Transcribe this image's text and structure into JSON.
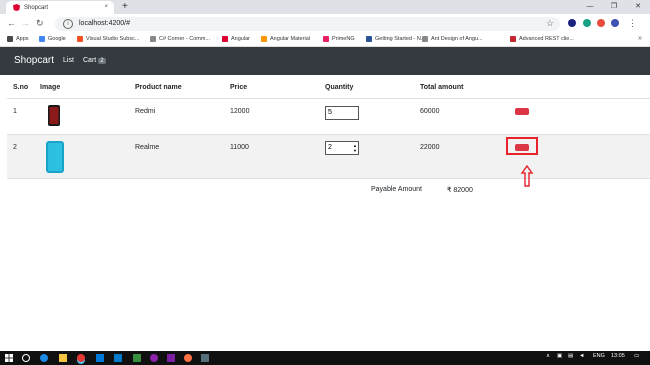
{
  "browser": {
    "tab_title": "Shopcart",
    "tab_close": "×",
    "new_tab": "+",
    "url": "localhost:4200/#",
    "controls": {
      "minimize": "—",
      "maximize": "❐",
      "close": "✕"
    },
    "bookmarks": [
      {
        "label": "Apps",
        "color": "#4a4a4a"
      },
      {
        "label": "Google",
        "color": "#4285f4"
      },
      {
        "label": "Visual Studio Subsc...",
        "color": "#f25022"
      },
      {
        "label": "C# Corner - Comm...",
        "color": "#888888"
      },
      {
        "label": "Angular",
        "color": "#dd0031"
      },
      {
        "label": "Angular Material",
        "color": "#ff9800"
      },
      {
        "label": "PrimeNG",
        "color": "#e91e63"
      },
      {
        "label": "Getting Started - N...",
        "color": "#2a5298"
      },
      {
        "label": "Ant Design of Angu...",
        "color": "#888888"
      },
      {
        "label": "Advanced REST clie...",
        "color": "#c1272d"
      }
    ],
    "more": "»"
  },
  "app": {
    "brand": "Shopcart",
    "nav": {
      "list": "List",
      "cart": "Cart",
      "cart_count": "2"
    },
    "table": {
      "headers": [
        "S.no",
        "Image",
        "Product name",
        "Price",
        "Quantity",
        "Total amount"
      ],
      "rows": [
        {
          "sno": "1",
          "name": "Redmi",
          "price": "12000",
          "quantity": "5",
          "total": "60000",
          "phone_color": "#8b1a1a"
        },
        {
          "sno": "2",
          "name": "Realme",
          "price": "11000",
          "quantity": "2",
          "total": "22000",
          "phone_color": "#1aa3c8"
        }
      ]
    },
    "payable_label": "Payable Amount",
    "payable_value": "₹ 82000"
  },
  "taskbar": {
    "lang": "ENG",
    "time": "13:05"
  }
}
